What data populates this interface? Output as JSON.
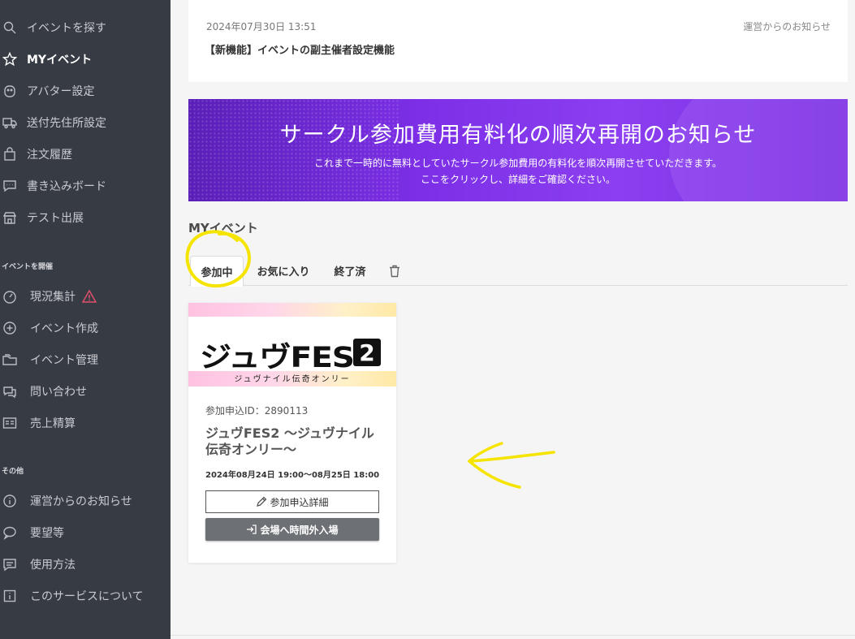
{
  "sidebar": {
    "sections": {
      "event_host": "イベントを開催",
      "other": "その他"
    },
    "items": [
      {
        "label": "イベントを探す",
        "icon": "search-icon"
      },
      {
        "label": "MYイベント",
        "icon": "star-icon",
        "active": true
      },
      {
        "label": "アバター設定",
        "icon": "avatar-icon"
      },
      {
        "label": "送付先住所設定",
        "icon": "truck-icon"
      },
      {
        "label": "注文履歴",
        "icon": "bag-icon"
      },
      {
        "label": "書き込みボード",
        "icon": "chat-icon"
      },
      {
        "label": "テスト出展",
        "icon": "store-icon"
      },
      {
        "label": "現況集計",
        "icon": "gauge-icon",
        "badge": "warning-icon"
      },
      {
        "label": "イベント作成",
        "icon": "plus-circle-icon"
      },
      {
        "label": "イベント管理",
        "icon": "folder-icon"
      },
      {
        "label": "問い合わせ",
        "icon": "question-chat-icon"
      },
      {
        "label": "売上精算",
        "icon": "receipt-icon"
      },
      {
        "label": "運営からのお知らせ",
        "icon": "info-icon"
      },
      {
        "label": "要望等",
        "icon": "speech-icon"
      },
      {
        "label": "使用方法",
        "icon": "manual-icon"
      },
      {
        "label": "このサービスについて",
        "icon": "about-icon"
      }
    ]
  },
  "notice": {
    "date": "2024年07月30日 13:51",
    "category": "運営からのお知らせ",
    "title": "【新機能】イベントの副主催者設定機能"
  },
  "banner": {
    "title": "サークル参加費用有料化の順次再開のお知らせ",
    "line1": "これまで一時的に無料としていたサークル参加費用の有料化を順次再開させていただきます。",
    "line2": "ここをクリックし、詳細をご確認ください。"
  },
  "my_events": {
    "heading": "MYイベント",
    "tabs": [
      "参加中",
      "お気に入り",
      "終了済"
    ],
    "active_tab": "参加中"
  },
  "event_card": {
    "logo_text": "ジュヴFES",
    "logo_num": "2",
    "logo_sub": "ジュヴナイル伝奇オンリー",
    "entry_id": "参加申込ID：2890113",
    "title": "ジュヴFES2 ～ジュヴナイル伝奇オンリー～",
    "date": "2024年08月24日 19:00～08月25日 18:00",
    "detail_button": "参加申込詳細",
    "enter_button": "会場へ時間外入場"
  },
  "colors": {
    "sidebar_bg": "#373b44",
    "banner_purple": "#7c2fe6",
    "annotation_yellow": "#f5e400",
    "enter_button_bg": "#6d7075"
  }
}
